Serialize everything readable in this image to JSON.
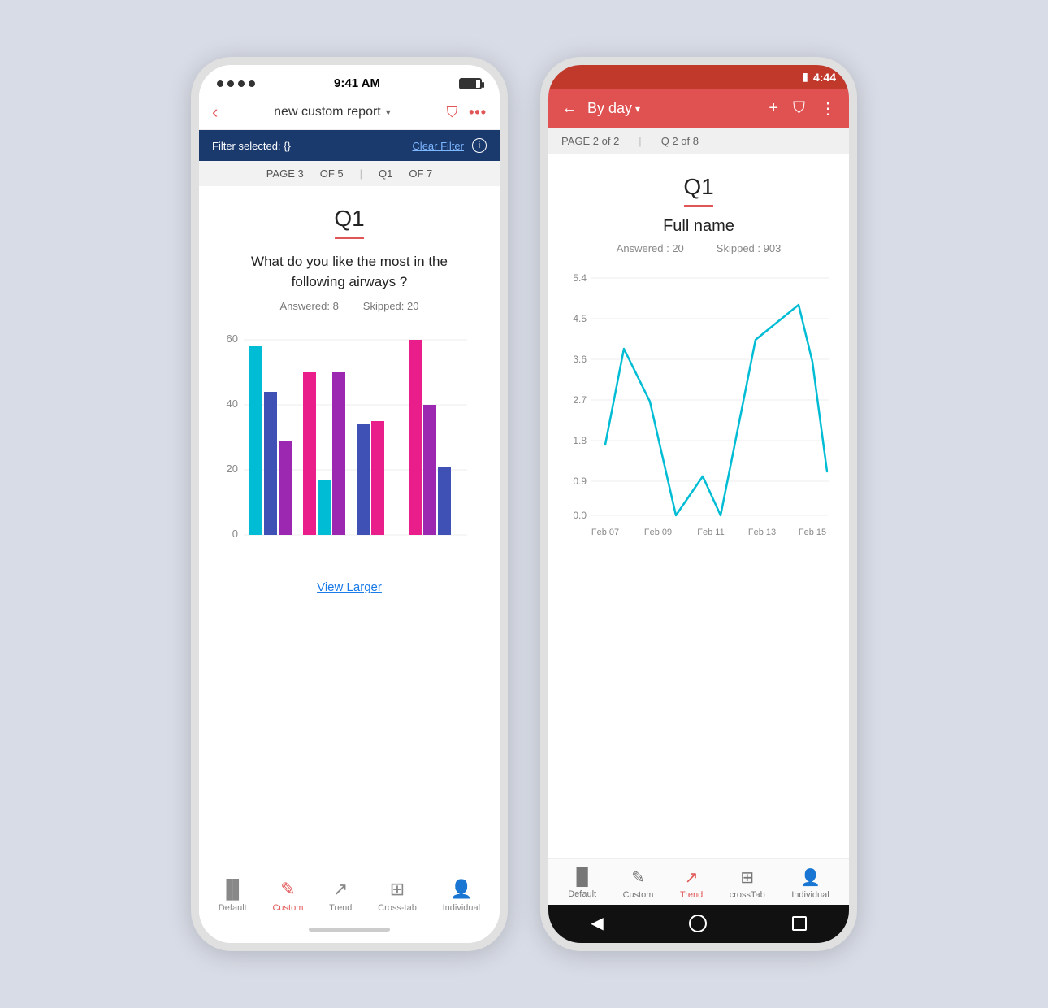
{
  "ios": {
    "status": {
      "time": "9:41 AM"
    },
    "nav": {
      "title": "new custom report",
      "back_label": "‹",
      "filter_icon": "⛉",
      "more_icon": "•••"
    },
    "filter_bar": {
      "text": "Filter selected: {}",
      "clear": "Clear Filter",
      "info": "i"
    },
    "page_bar": {
      "page": "PAGE 3",
      "of_pages": "OF 5",
      "separator": "|",
      "q": "Q1",
      "of_q": "OF 7"
    },
    "question": {
      "label": "Q1",
      "text": "What do you like the most in the following airways ?",
      "answered_label": "Answered:",
      "answered_val": "8",
      "skipped_label": "Skipped:",
      "skipped_val": "20"
    },
    "view_larger": "View Larger",
    "tabs": [
      {
        "id": "default",
        "label": "Default",
        "active": false
      },
      {
        "id": "custom",
        "label": "Custom",
        "active": true
      },
      {
        "id": "trend",
        "label": "Trend",
        "active": false
      },
      {
        "id": "crosstab",
        "label": "Cross-tab",
        "active": false
      },
      {
        "id": "individual",
        "label": "Individual",
        "active": false
      }
    ],
    "chart": {
      "y_max": 60,
      "y_labels": [
        "60",
        "40",
        "20",
        "0"
      ],
      "groups": [
        {
          "bars": [
            58,
            44,
            29
          ],
          "colors": [
            "#00bcd4",
            "#3f51b5",
            "#9c27b0"
          ]
        },
        {
          "bars": [
            50,
            17,
            50
          ],
          "colors": [
            "#e91e8a",
            "#00bcd4",
            "#9c27b0"
          ]
        },
        {
          "bars": [
            34,
            35,
            0
          ],
          "colors": [
            "#3f51b5",
            "#e91e8a",
            ""
          ]
        },
        {
          "bars": [
            60,
            40,
            21
          ],
          "colors": [
            "#e91e8a",
            "#9c27b0",
            "#3f51b5"
          ]
        }
      ]
    }
  },
  "android": {
    "status": {
      "time": "4:44",
      "battery": "▮"
    },
    "toolbar": {
      "back": "←",
      "title": "By day",
      "drop": "▾",
      "add": "+",
      "filter": "⛉",
      "more": "⋮"
    },
    "page_bar": {
      "page": "PAGE 2 of 2",
      "separator": "|",
      "q": "Q 2 of 8"
    },
    "question": {
      "label": "Q1",
      "text": "Full name",
      "answered_label": "Answered : 20",
      "skipped_label": "Skipped : 903"
    },
    "chart": {
      "y_labels": [
        "5.4",
        "4.5",
        "3.6",
        "2.7",
        "1.8",
        "0.9",
        "0.0"
      ],
      "x_labels": [
        "Feb 07",
        "Feb 09",
        "Feb 11",
        "Feb 13",
        "Feb 15"
      ],
      "points": [
        {
          "x": 0,
          "y": 1.6
        },
        {
          "x": 1,
          "y": 3.8
        },
        {
          "x": 2,
          "y": 2.6
        },
        {
          "x": 3,
          "y": 0.05
        },
        {
          "x": 4,
          "y": 0.9
        },
        {
          "x": 5,
          "y": 0.05
        },
        {
          "x": 6,
          "y": 4.0
        },
        {
          "x": 7,
          "y": 4.8
        },
        {
          "x": 8,
          "y": 3.5
        },
        {
          "x": 9,
          "y": 1.0
        }
      ]
    },
    "tabs": [
      {
        "id": "default",
        "label": "Default",
        "active": false
      },
      {
        "id": "custom",
        "label": "Custom",
        "active": false
      },
      {
        "id": "trend",
        "label": "Trend",
        "active": true
      },
      {
        "id": "crosstab",
        "label": "crossTab",
        "active": false
      },
      {
        "id": "individual",
        "label": "Individual",
        "active": false
      }
    ]
  }
}
